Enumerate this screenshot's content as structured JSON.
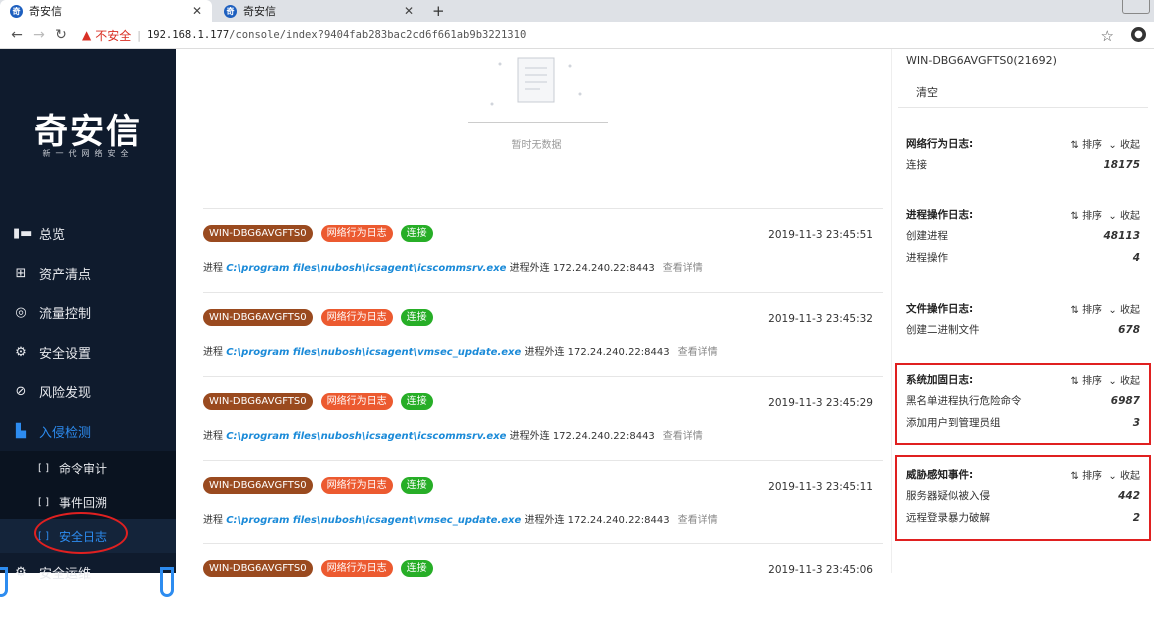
{
  "browser": {
    "tabs": [
      {
        "title": "奇安信"
      },
      {
        "title": "奇安信"
      }
    ],
    "security_label": "不安全",
    "url_host": "192.168.1.177",
    "url_path": "/console/index?9404fab283bac2cd6f661ab9b3221310"
  },
  "sidebar": {
    "logo": "奇安信",
    "slogan": "新一代网络安全",
    "items": [
      {
        "label": "总览",
        "icon": "overview-icon"
      },
      {
        "label": "资产清点",
        "icon": "asset-icon"
      },
      {
        "label": "流量控制",
        "icon": "traffic-icon"
      },
      {
        "label": "安全设置",
        "icon": "settings-icon"
      },
      {
        "label": "风险发现",
        "icon": "risk-icon"
      },
      {
        "label": "入侵检测",
        "icon": "intrusion-icon"
      }
    ],
    "subitems": [
      {
        "label": "命令审计"
      },
      {
        "label": "事件回溯"
      },
      {
        "label": "安全日志"
      }
    ],
    "last_item": "安全运维",
    "active_color": "#2d8cf0"
  },
  "main": {
    "no_data": "暂时无数据",
    "entries": [
      {
        "host": "WIN-DBG6AVGFTS0",
        "type": "网络行为日志",
        "action": "连接",
        "time": "2019-11-3 23:45:51",
        "prefix": "进程",
        "path": "C:\\program files\\nubosh\\icsagent\\icscommsrv.exe",
        "suffix": "进程外连 172.24.240.22:8443",
        "detail": "查看详情"
      },
      {
        "host": "WIN-DBG6AVGFTS0",
        "type": "网络行为日志",
        "action": "连接",
        "time": "2019-11-3 23:45:32",
        "prefix": "进程",
        "path": "C:\\program files\\nubosh\\icsagent\\vmsec_update.exe",
        "suffix": "进程外连 172.24.240.22:8443",
        "detail": "查看详情"
      },
      {
        "host": "WIN-DBG6AVGFTS0",
        "type": "网络行为日志",
        "action": "连接",
        "time": "2019-11-3 23:45:29",
        "prefix": "进程",
        "path": "C:\\program files\\nubosh\\icsagent\\icscommsrv.exe",
        "suffix": "进程外连 172.24.240.22:8443",
        "detail": "查看详情"
      },
      {
        "host": "WIN-DBG6AVGFTS0",
        "type": "网络行为日志",
        "action": "连接",
        "time": "2019-11-3 23:45:11",
        "prefix": "进程",
        "path": "C:\\program files\\nubosh\\icsagent\\vmsec_update.exe",
        "suffix": "进程外连 172.24.240.22:8443",
        "detail": "查看详情"
      },
      {
        "host": "WIN-DBG6AVGFTS0",
        "type": "网络行为日志",
        "action": "连接",
        "time": "2019-11-3 23:45:06",
        "prefix": "",
        "path": "",
        "suffix": "",
        "detail": ""
      }
    ]
  },
  "right_panel": {
    "host": "WIN-DBG6AVGFTS0(21692)",
    "clear": "清空",
    "sort": "排序",
    "collapse": "收起",
    "sections": [
      {
        "title": "网络行为日志:",
        "rows": [
          {
            "label": "连接",
            "value": "18175"
          }
        ]
      },
      {
        "title": "进程操作日志:",
        "rows": [
          {
            "label": "创建进程",
            "value": "48113"
          },
          {
            "label": "进程操作",
            "value": "4"
          }
        ]
      },
      {
        "title": "文件操作日志:",
        "rows": [
          {
            "label": "创建二进制文件",
            "value": "678"
          }
        ]
      },
      {
        "title": "系统加固日志:",
        "rows": [
          {
            "label": "黑名单进程执行危险命令",
            "value": "6987"
          },
          {
            "label": "添加用户到管理员组",
            "value": "3"
          }
        ]
      },
      {
        "title": "威胁感知事件:",
        "rows": [
          {
            "label": "服务器疑似被入侵",
            "value": "442"
          },
          {
            "label": "远程登录暴力破解",
            "value": "2"
          }
        ]
      }
    ]
  },
  "colors": {
    "host_badge": "#9a4a1f",
    "type_badge": "#ec5a30",
    "action_badge": "#27ae27",
    "highlight": "#e02020"
  }
}
